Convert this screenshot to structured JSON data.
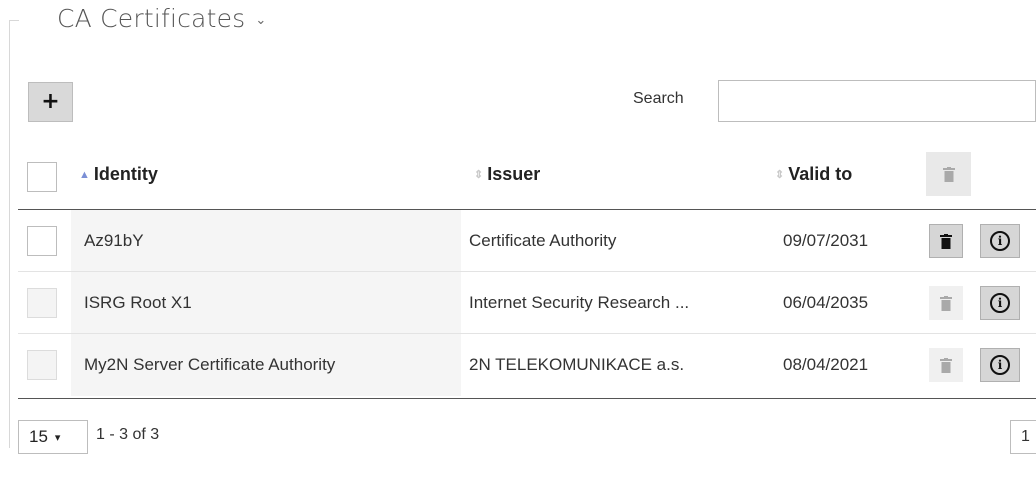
{
  "section": {
    "title": "CA Certificates",
    "chevron": "⌄"
  },
  "toolbar": {
    "add_label": "+",
    "search_label": "Search",
    "search_value": "",
    "search_placeholder": ""
  },
  "table": {
    "columns": [
      "Identity",
      "Issuer",
      "Valid to"
    ],
    "rows": [
      {
        "identity": "Az91bY",
        "issuer": "Certificate Authority",
        "valid_to": "09/07/2031",
        "checkbox_enabled": true,
        "delete_enabled": true
      },
      {
        "identity": "ISRG Root X1",
        "issuer": "Internet Security Research ...",
        "valid_to": "06/04/2035",
        "checkbox_enabled": false,
        "delete_enabled": false
      },
      {
        "identity": "My2N Server Certificate Authority",
        "issuer": "2N TELEKOMUNIKACE a.s.",
        "valid_to": "08/04/2021",
        "checkbox_enabled": false,
        "delete_enabled": false
      }
    ]
  },
  "pagination": {
    "page_size": "15",
    "range_text": "1 - 3 of 3",
    "current_page": "1"
  },
  "icons": {
    "add": "plus-icon",
    "delete": "trash-icon",
    "info": "info-icon",
    "sort": "sort-icon",
    "dropdown": "chevron-down-icon"
  },
  "colors": {
    "sort_active": "#7b8fd6",
    "button_bg": "#d6d6d6"
  }
}
